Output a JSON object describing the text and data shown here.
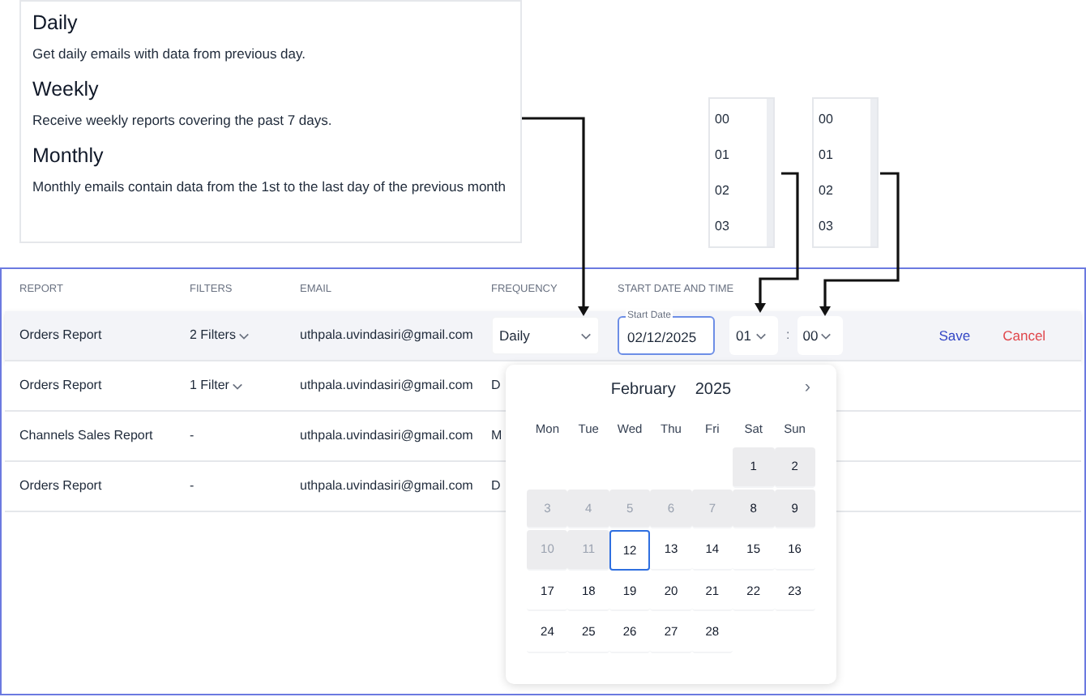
{
  "frequency_options": [
    {
      "title": "Daily",
      "description": "Get daily emails with data from previous day."
    },
    {
      "title": "Weekly",
      "description": "Receive weekly reports covering the past 7 days."
    },
    {
      "title": "Monthly",
      "description": "Monthly emails contain data from the 1st to the last day of the previous month"
    }
  ],
  "hour_list": [
    "00",
    "01",
    "02",
    "03"
  ],
  "minute_list": [
    "00",
    "01",
    "02",
    "03"
  ],
  "table": {
    "columns": [
      "REPORT",
      "FILTERS",
      "EMAIL",
      "FREQUENCY",
      "START DATE AND TIME"
    ],
    "rows": [
      {
        "report": "Orders Report",
        "filters": "2 Filters",
        "filters_dropdown": true,
        "email": "uthpala.uvindasiri@gmail.com",
        "frequency": "Daily",
        "editing": true
      },
      {
        "report": "Orders Report",
        "filters": "1 Filter",
        "filters_dropdown": true,
        "email": "uthpala.uvindasiri@gmail.com",
        "frequency": "D",
        "editing": false
      },
      {
        "report": "Channels Sales Report",
        "filters": "-",
        "filters_dropdown": false,
        "email": "uthpala.uvindasiri@gmail.com",
        "frequency": "M",
        "editing": false
      },
      {
        "report": "Orders Report",
        "filters": "-",
        "filters_dropdown": false,
        "email": "uthpala.uvindasiri@gmail.com",
        "frequency": "D",
        "editing": false
      }
    ]
  },
  "editor": {
    "date_label": "Start Date",
    "date_value": "02/12/2025",
    "hour": "01",
    "separator": ":",
    "minute": "00",
    "save": "Save",
    "cancel": "Cancel"
  },
  "calendar": {
    "month": "February",
    "year": "2025",
    "next": "›",
    "weekdays": [
      "Mon",
      "Tue",
      "Wed",
      "Thu",
      "Fri",
      "Sat",
      "Sun"
    ],
    "weeks": [
      [
        {
          "label": "1",
          "past": true,
          "disabled": false,
          "selected": false
        },
        {
          "label": "2",
          "past": true,
          "disabled": false,
          "selected": false
        }
      ],
      [
        {
          "label": "3",
          "past": true,
          "disabled": true,
          "selected": false
        },
        {
          "label": "4",
          "past": true,
          "disabled": true,
          "selected": false
        },
        {
          "label": "5",
          "past": true,
          "disabled": true,
          "selected": false
        },
        {
          "label": "6",
          "past": true,
          "disabled": true,
          "selected": false
        },
        {
          "label": "7",
          "past": true,
          "disabled": true,
          "selected": false
        },
        {
          "label": "8",
          "past": true,
          "disabled": false,
          "selected": false
        },
        {
          "label": "9",
          "past": true,
          "disabled": false,
          "selected": false
        }
      ],
      [
        {
          "label": "10",
          "past": true,
          "disabled": true,
          "selected": false
        },
        {
          "label": "11",
          "past": true,
          "disabled": true,
          "selected": false
        },
        {
          "label": "12",
          "past": false,
          "disabled": false,
          "selected": true
        },
        {
          "label": "13",
          "past": false,
          "disabled": false,
          "selected": false
        },
        {
          "label": "14",
          "past": false,
          "disabled": false,
          "selected": false
        },
        {
          "label": "15",
          "past": false,
          "disabled": false,
          "selected": false
        },
        {
          "label": "16",
          "past": false,
          "disabled": false,
          "selected": false
        }
      ],
      [
        {
          "label": "17",
          "past": false,
          "disabled": false,
          "selected": false
        },
        {
          "label": "18",
          "past": false,
          "disabled": false,
          "selected": false
        },
        {
          "label": "19",
          "past": false,
          "disabled": false,
          "selected": false
        },
        {
          "label": "20",
          "past": false,
          "disabled": false,
          "selected": false
        },
        {
          "label": "21",
          "past": false,
          "disabled": false,
          "selected": false
        },
        {
          "label": "22",
          "past": false,
          "disabled": false,
          "selected": false
        },
        {
          "label": "23",
          "past": false,
          "disabled": false,
          "selected": false
        }
      ],
      [
        {
          "label": "24",
          "past": false,
          "disabled": false,
          "selected": false
        },
        {
          "label": "25",
          "past": false,
          "disabled": false,
          "selected": false
        },
        {
          "label": "26",
          "past": false,
          "disabled": false,
          "selected": false
        },
        {
          "label": "27",
          "past": false,
          "disabled": false,
          "selected": false
        },
        {
          "label": "28",
          "past": false,
          "disabled": false,
          "selected": false
        }
      ]
    ]
  }
}
